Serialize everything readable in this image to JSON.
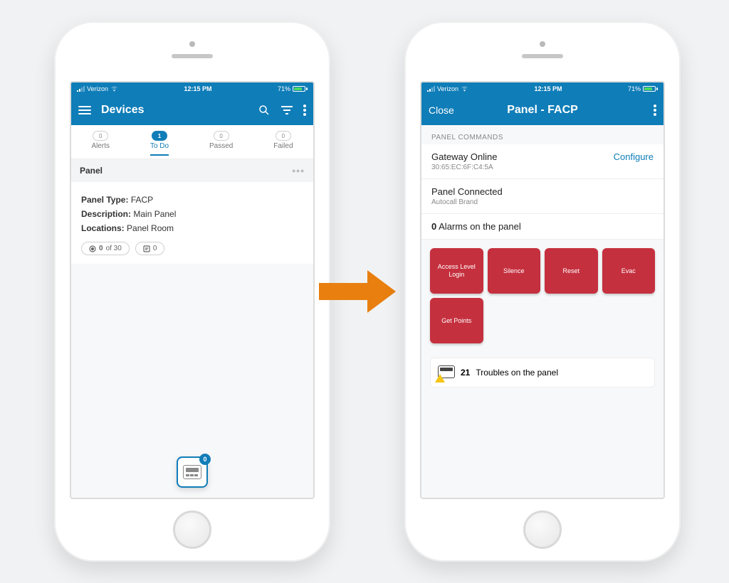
{
  "status_bar": {
    "carrier": "Verizon",
    "time": "12:15 PM",
    "battery_pct": "71%"
  },
  "left": {
    "title": "Devices",
    "tabs": [
      {
        "label": "Alerts",
        "count": "0"
      },
      {
        "label": "To Do",
        "count": "1"
      },
      {
        "label": "Passed",
        "count": "0"
      },
      {
        "label": "Failed",
        "count": "0"
      }
    ],
    "section_title": "Panel",
    "props": {
      "type_label": "Panel Type:",
      "type_value": "FACP",
      "desc_label": "Description:",
      "desc_value": "Main Panel",
      "loc_label": "Locations:",
      "loc_value": "Panel Room"
    },
    "chip_progress_done": "0",
    "chip_progress_of": "of 30",
    "chip_notes": "0",
    "floating_badge": "0"
  },
  "right": {
    "close_label": "Close",
    "title": "Panel - FACP",
    "commands_heading": "PANEL COMMANDS",
    "gateway": {
      "title": "Gateway Online",
      "mac": "30:65:EC:6F:C4:5A",
      "action": "Configure"
    },
    "panel": {
      "title": "Panel Connected",
      "brand": "Autocall Brand"
    },
    "alarms_count": "0",
    "alarms_text": "Alarms on the panel",
    "commands": [
      "Access Level Login",
      "Silence",
      "Reset",
      "Evac",
      "Get Points"
    ],
    "troubles_count": "21",
    "troubles_text": "Troubles on the panel"
  }
}
